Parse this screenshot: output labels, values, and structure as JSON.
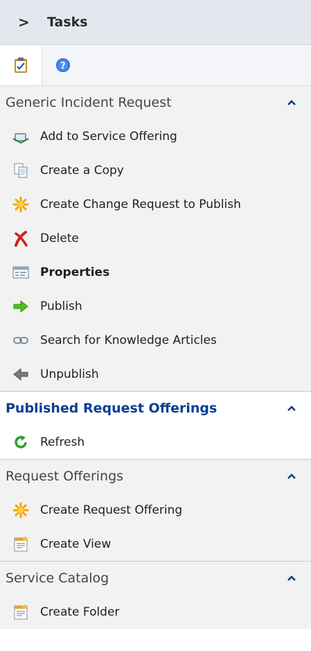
{
  "header": {
    "toggle_glyph": ">",
    "title": "Tasks"
  },
  "tabs": [
    {
      "name": "tasks-tab",
      "icon": "clipboard-icon"
    },
    {
      "name": "help-tab",
      "icon": "help-icon"
    }
  ],
  "sections": {
    "generic": {
      "title": "Generic Incident Request",
      "items": [
        "Add to Service Offering",
        "Create a Copy",
        "Create Change Request to Publish",
        "Delete",
        "Properties",
        "Publish",
        "Search for Knowledge Articles",
        "Unpublish"
      ]
    },
    "published": {
      "title": "Published Request Offerings",
      "items": [
        "Refresh"
      ]
    },
    "request_offerings": {
      "title": "Request Offerings",
      "items": [
        "Create Request Offering",
        "Create View"
      ]
    },
    "service_catalog": {
      "title": "Service Catalog",
      "items": [
        "Create Folder"
      ]
    }
  },
  "colors": {
    "accent_title": "#0b3d91",
    "header_bg": "#e4e8ee",
    "section_bg": "#f2f2f2"
  }
}
